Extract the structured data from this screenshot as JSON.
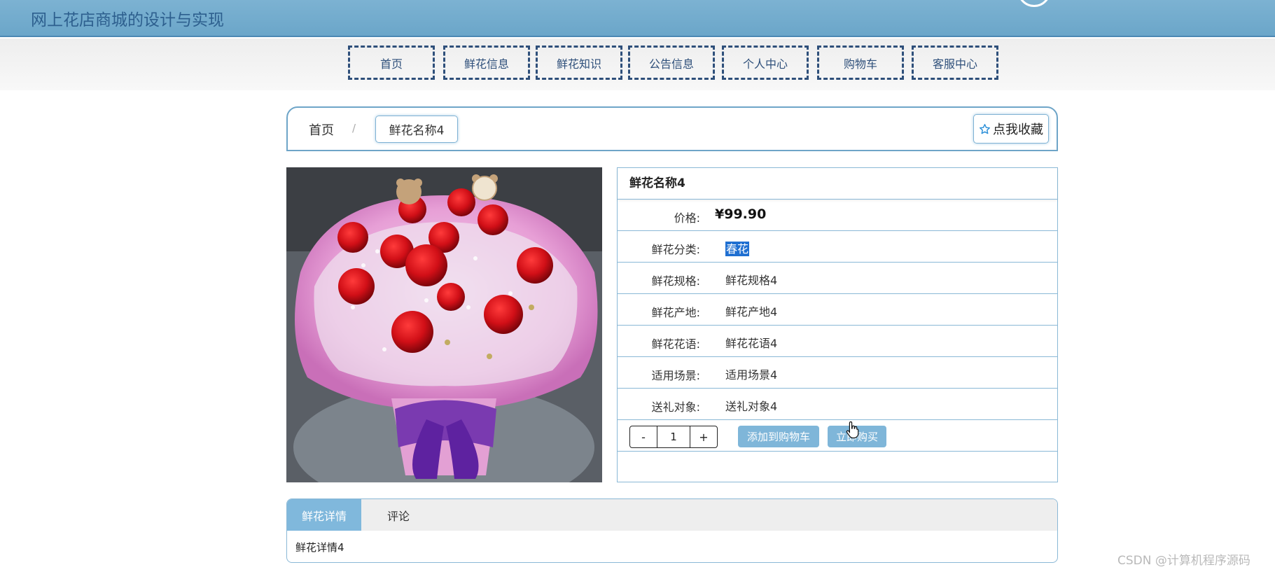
{
  "header": {
    "site_title": "网上花店商城的设计与实现"
  },
  "nav": {
    "items": [
      {
        "label": "首页"
      },
      {
        "label": "鲜花信息"
      },
      {
        "label": "鲜花知识"
      },
      {
        "label": "公告信息"
      },
      {
        "label": "个人中心"
      },
      {
        "label": "购物车"
      },
      {
        "label": "客服中心"
      }
    ]
  },
  "breadcrumb": {
    "home": "首页",
    "separator": "/",
    "current": "鲜花名称4"
  },
  "favorite": {
    "label": "点我收藏",
    "icon": "star-outline-icon"
  },
  "product": {
    "name": "鲜花名称4",
    "price_label": "价格:",
    "price": "¥99.90",
    "fields": [
      {
        "label": "鲜花分类:",
        "value": "春花"
      },
      {
        "label": "鲜花规格:",
        "value": "鲜花规格4"
      },
      {
        "label": "鲜花产地:",
        "value": "鲜花产地4"
      },
      {
        "label": "鲜花花语:",
        "value": "鲜花花语4"
      },
      {
        "label": "适用场景:",
        "value": "适用场景4"
      },
      {
        "label": "送礼对象:",
        "value": "送礼对象4"
      }
    ],
    "quantity": {
      "minus": "-",
      "value": "1",
      "plus": "+"
    },
    "add_to_cart": "添加到购物车",
    "buy_now": "立即购买"
  },
  "tabs": {
    "items": [
      {
        "label": "鲜花详情"
      },
      {
        "label": "评论"
      }
    ],
    "content": "鲜花详情4"
  },
  "watermark": "CSDN @计算机程序源码",
  "colors": {
    "accent": "#80b8dc",
    "nav_border": "#2e4f7a",
    "header": "#6ba6c9",
    "selection": "#1f6fd1"
  }
}
